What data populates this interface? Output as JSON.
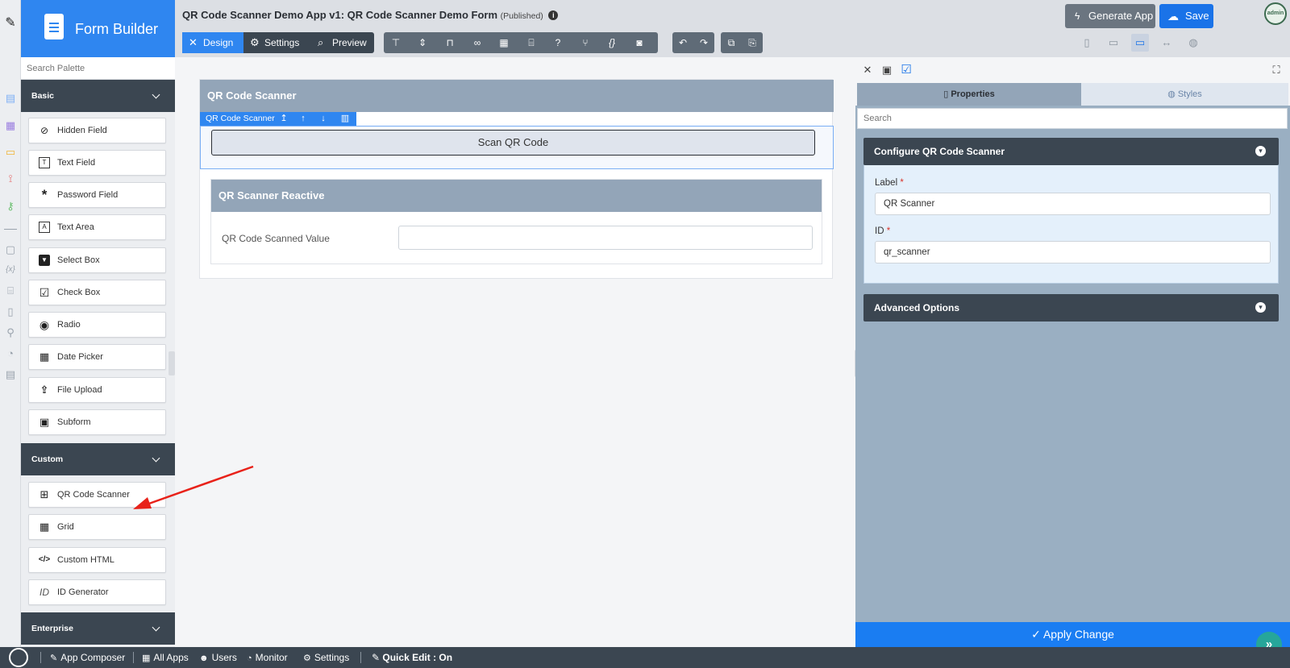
{
  "brand": {
    "title": "Form Builder"
  },
  "palette": {
    "search_placeholder": "Search Palette",
    "sections": {
      "basic": "Basic",
      "custom": "Custom",
      "enterprise": "Enterprise"
    },
    "basic_items": [
      {
        "label": "Hidden Field",
        "icon": "eye-slash-icon"
      },
      {
        "label": "Text Field",
        "icon": "text-field-icon"
      },
      {
        "label": "Password Field",
        "icon": "asterisk-icon"
      },
      {
        "label": "Text Area",
        "icon": "text-area-icon"
      },
      {
        "label": "Select Box",
        "icon": "select-box-icon"
      },
      {
        "label": "Check Box",
        "icon": "checkbox-icon"
      },
      {
        "label": "Radio",
        "icon": "radio-icon"
      },
      {
        "label": "Date Picker",
        "icon": "calendar-icon"
      },
      {
        "label": "File Upload",
        "icon": "upload-icon"
      },
      {
        "label": "Subform",
        "icon": "subform-icon"
      }
    ],
    "custom_items": [
      {
        "label": "QR Code Scanner",
        "icon": "qr-code-icon"
      },
      {
        "label": "Grid",
        "icon": "table-icon"
      },
      {
        "label": "Custom HTML",
        "icon": "code-icon"
      },
      {
        "label": "ID Generator",
        "icon": "id-icon",
        "glyph": "ID"
      }
    ]
  },
  "header": {
    "title": "QR Code Scanner Demo App v1: QR Code Scanner Demo Form",
    "status": "(Published)",
    "modes": {
      "design": "Design",
      "settings": "Settings",
      "preview": "Preview"
    },
    "generate_label": "Generate App",
    "save_label": "Save",
    "avatar_text": "admin"
  },
  "form": {
    "section_title": "QR Code Scanner",
    "selected_element": "QR Code Scanner",
    "scan_button": "Scan QR Code",
    "reactive_title": "QR Scanner Reactive",
    "reactive_field_label": "QR Code Scanned Value"
  },
  "properties": {
    "tab_properties": "Properties",
    "tab_styles": "Styles",
    "search_placeholder": "Search",
    "configure_title": "Configure QR Code Scanner",
    "label_label": "Label",
    "label_value": "QR Scanner",
    "id_label": "ID",
    "id_value": "qr_scanner",
    "required_mark": "*",
    "advanced_title": "Advanced Options",
    "apply_label": "Apply Change"
  },
  "statusbar": {
    "app_composer": "App Composer",
    "all_apps": "All Apps",
    "users": "Users",
    "monitor": "Monitor",
    "settings": "Settings",
    "quick_edit": "Quick Edit : On"
  },
  "colors": {
    "accent": "#2f86f0",
    "dark": "#3b4651",
    "panel": "#9aafc2",
    "annotation_arrow": "#e8221a"
  }
}
